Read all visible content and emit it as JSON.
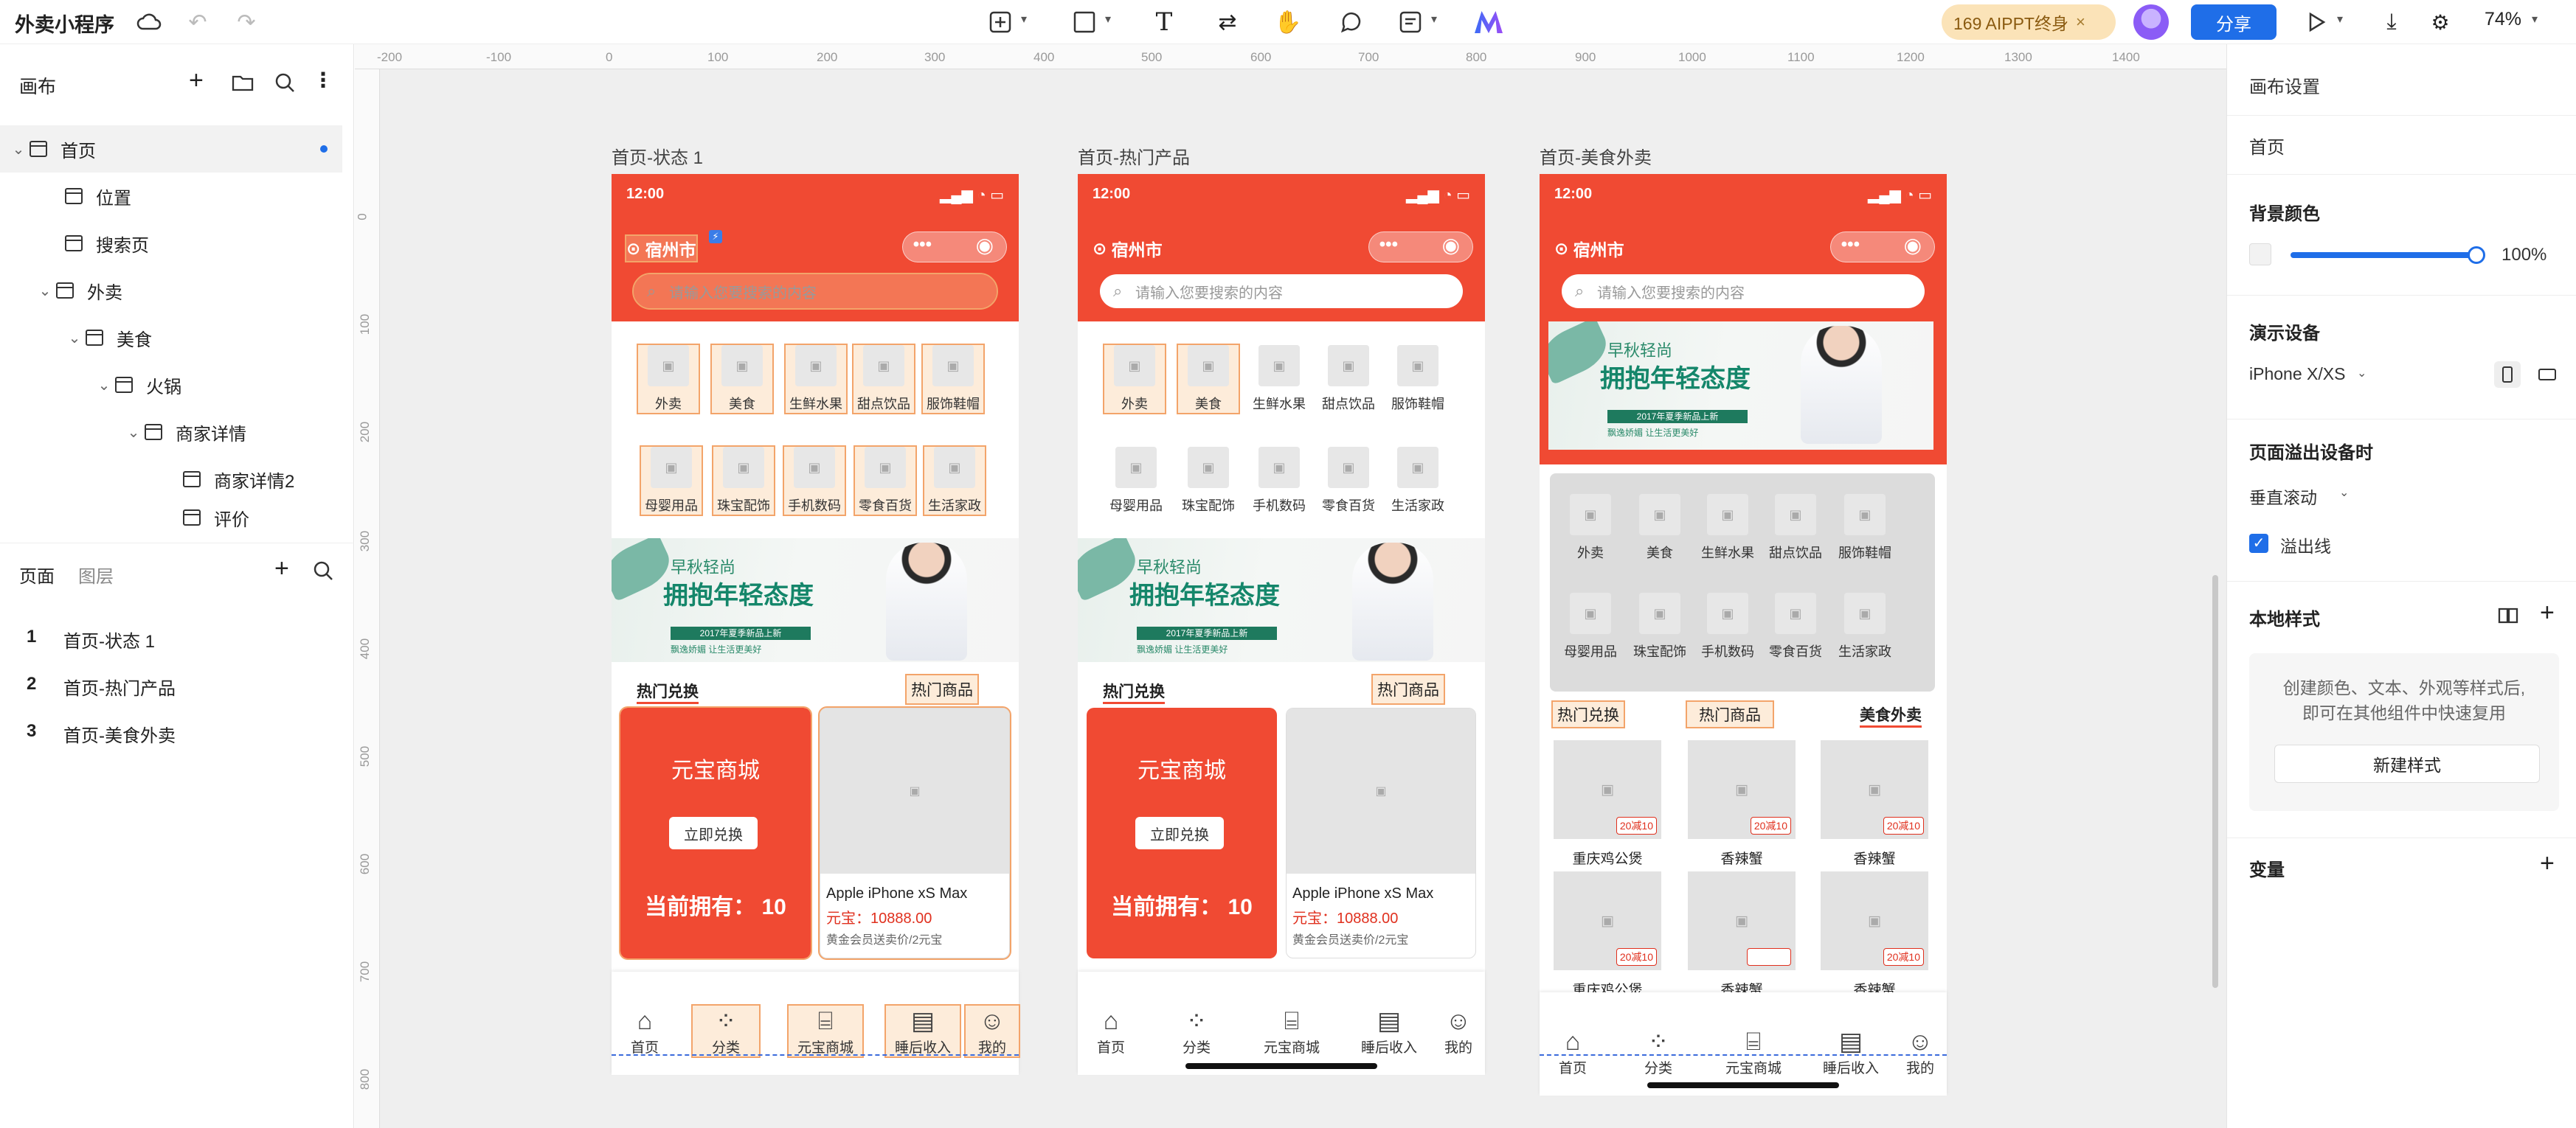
{
  "app": {
    "title": "外卖小程序"
  },
  "toolbar": {
    "aippt_label": "169 AIPPT终身",
    "share_label": "分享",
    "zoom": "74%"
  },
  "left_panel": {
    "canvas_label": "画布",
    "tree": [
      {
        "label": "首页"
      },
      {
        "label": "位置"
      },
      {
        "label": "搜索页"
      },
      {
        "label": "外卖"
      },
      {
        "label": "美食"
      },
      {
        "label": "火锅"
      },
      {
        "label": "商家详情"
      },
      {
        "label": "商家详情2"
      },
      {
        "label": "评价"
      }
    ],
    "tabs": {
      "pages": "页面",
      "layers": "图层"
    },
    "pages": [
      {
        "num": "1",
        "label": "首页-状态 1"
      },
      {
        "num": "2",
        "label": "首页-热门产品"
      },
      {
        "num": "3",
        "label": "首页-美食外卖"
      }
    ]
  },
  "ruler": {
    "h": [
      "-200",
      "-100",
      "0",
      "100",
      "200",
      "300",
      "400",
      "500",
      "600",
      "700",
      "800",
      "900",
      "1000",
      "1100",
      "1200",
      "1300",
      "1400"
    ],
    "v": [
      "0",
      "100",
      "200",
      "300",
      "400",
      "500",
      "600",
      "700",
      "800"
    ]
  },
  "frames": [
    {
      "title": "首页-状态 1"
    },
    {
      "title": "首页-热门产品"
    },
    {
      "title": "首页-美食外卖"
    }
  ],
  "phone": {
    "time": "12:00",
    "city": "宿州市",
    "search_placeholder": "请输入您要搜索的内容",
    "categories": [
      "外卖",
      "美食",
      "生鲜水果",
      "甜点饮品",
      "服饰鞋帽",
      "母婴用品",
      "珠宝配饰",
      "手机数码",
      "零食百货",
      "生活家政"
    ],
    "banner": {
      "line1": "早秋轻尚",
      "line2": "拥抱年轻态度",
      "line3": "2017年夏季新品上新",
      "line4": "飘逸娇媚 让生活更美好"
    },
    "hot_exchange": "热门兑换",
    "hot_goods": "热门商品",
    "food_delivery": "美食外卖",
    "yuanbao": {
      "title": "元宝商城",
      "button": "立即兑换",
      "owned": "当前拥有：  10"
    },
    "product": {
      "name": "Apple iPhone xS Max",
      "price": "元宝：10888.00",
      "note": "黄金会员送卖价/2元宝"
    },
    "food_items": [
      {
        "name": "重庆鸡公煲",
        "tag": "20减10"
      },
      {
        "name": "香辣蟹",
        "tag": "20减10"
      },
      {
        "name": "香辣蟹",
        "tag": "20减10"
      },
      {
        "name": "重庆鸡公煲",
        "tag": "20减10"
      },
      {
        "name": "香辣蟹",
        "tag": ""
      },
      {
        "name": "香辣蟹",
        "tag": "20减10"
      }
    ],
    "tabs": [
      "首页",
      "分类",
      "元宝商城",
      "睡后收入",
      "我的"
    ]
  },
  "right_panel": {
    "canvas_settings": "画布设置",
    "page_name": "首页",
    "bg_color_label": "背景颜色",
    "bg_opacity": "100%",
    "device_label": "演示设备",
    "device_value": "iPhone X/XS",
    "overflow_label": "页面溢出设备时",
    "overflow_value": "垂直滚动",
    "overflow_line": "溢出线",
    "local_style_label": "本地样式",
    "local_style_desc1": "创建颜色、文本、外观等样式后,",
    "local_style_desc2": "即可在其他组件中快速复用",
    "new_style_button": "新建样式",
    "variables_label": "变量"
  },
  "colors": {
    "accent": "#1f6ee8",
    "brand_red": "#f04a33",
    "highlight": "#f3a46a"
  }
}
